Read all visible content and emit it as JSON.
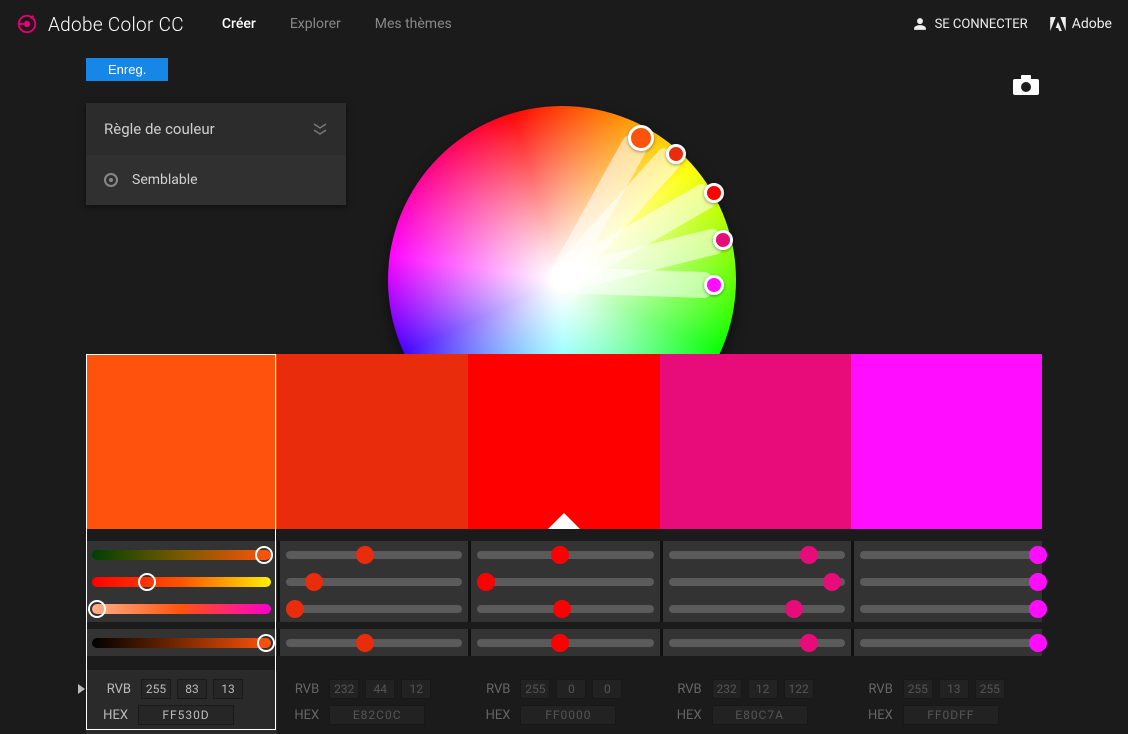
{
  "header": {
    "app_name": "Adobe Color CC",
    "nav": {
      "create": "Créer",
      "explore": "Explorer",
      "themes": "Mes thèmes"
    },
    "signin": "SE CONNECTER",
    "adobe": "Adobe"
  },
  "toolbar": {
    "save": "Enreg."
  },
  "rule_panel": {
    "title": "Règle de couleur",
    "current": "Semblable"
  },
  "labels": {
    "rgb": "RVB",
    "hex": "HEX"
  },
  "swatches": [
    {
      "hex": "FF530D",
      "rgb": [
        255,
        83,
        13
      ],
      "active": true,
      "base": false
    },
    {
      "hex": "E82C0C",
      "rgb": [
        232,
        44,
        12
      ],
      "active": false,
      "base": false
    },
    {
      "hex": "FF0000",
      "rgb": [
        255,
        0,
        0
      ],
      "active": false,
      "base": true
    },
    {
      "hex": "E80C7A",
      "rgb": [
        232,
        12,
        122
      ],
      "active": false,
      "base": false
    },
    {
      "hex": "FF0DFF",
      "rgb": [
        255,
        13,
        255
      ],
      "active": false,
      "base": false
    }
  ],
  "wheel_handles": [
    {
      "angle": -61,
      "rad": 162,
      "color": "#FF530D",
      "big": true
    },
    {
      "angle": -48,
      "rad": 170,
      "color": "#E82C0C"
    },
    {
      "angle": -30,
      "rad": 175,
      "color": "#FF0000"
    },
    {
      "angle": -14,
      "rad": 166,
      "color": "#E80C7A"
    },
    {
      "angle": 2,
      "rad": 152,
      "color": "#FF0DFF"
    }
  ],
  "slider_rows": [
    {
      "grad_first": "linear-gradient(90deg,#004000,#7a5a00,#ff530d)",
      "cells": [
        {
          "first": true,
          "pos": 93,
          "color": "#FF530D"
        },
        {
          "pos": 45,
          "color": "#E82C0C"
        },
        {
          "pos": 47,
          "color": "#FF0000"
        },
        {
          "pos": 78,
          "color": "#E80C7A"
        },
        {
          "pos": 98,
          "color": "#FF0DFF"
        }
      ]
    },
    {
      "grad_first": "linear-gradient(90deg,#ff0000,#ff5400,#fff000)",
      "cells": [
        {
          "first": true,
          "pos": 32,
          "color": "#FF530D"
        },
        {
          "pos": 18,
          "color": "#E82C0C"
        },
        {
          "pos": 8,
          "color": "#FF0000"
        },
        {
          "pos": 90,
          "color": "#E80C7A"
        },
        {
          "pos": 98,
          "color": "#FF0DFF"
        }
      ]
    },
    {
      "grad_first": "linear-gradient(90deg,#ffb088,#ff530d,#ff00cc)",
      "cells": [
        {
          "first": true,
          "pos": 6,
          "color": "#FF530D"
        },
        {
          "pos": 8,
          "color": "#E82C0C"
        },
        {
          "pos": 48,
          "color": "#FF0000"
        },
        {
          "pos": 70,
          "color": "#E80C7A"
        },
        {
          "pos": 98,
          "color": "#FF0DFF"
        }
      ]
    },
    {
      "gap": true
    },
    {
      "grad_first": "linear-gradient(90deg,#000,#7a2a00,#ff530d)",
      "cells": [
        {
          "first": true,
          "pos": 94,
          "color": "#FF530D"
        },
        {
          "pos": 45,
          "color": "#E82C0C"
        },
        {
          "pos": 47,
          "color": "#FF0000"
        },
        {
          "pos": 78,
          "color": "#E80C7A"
        },
        {
          "pos": 98,
          "color": "#FF0DFF"
        }
      ]
    }
  ]
}
